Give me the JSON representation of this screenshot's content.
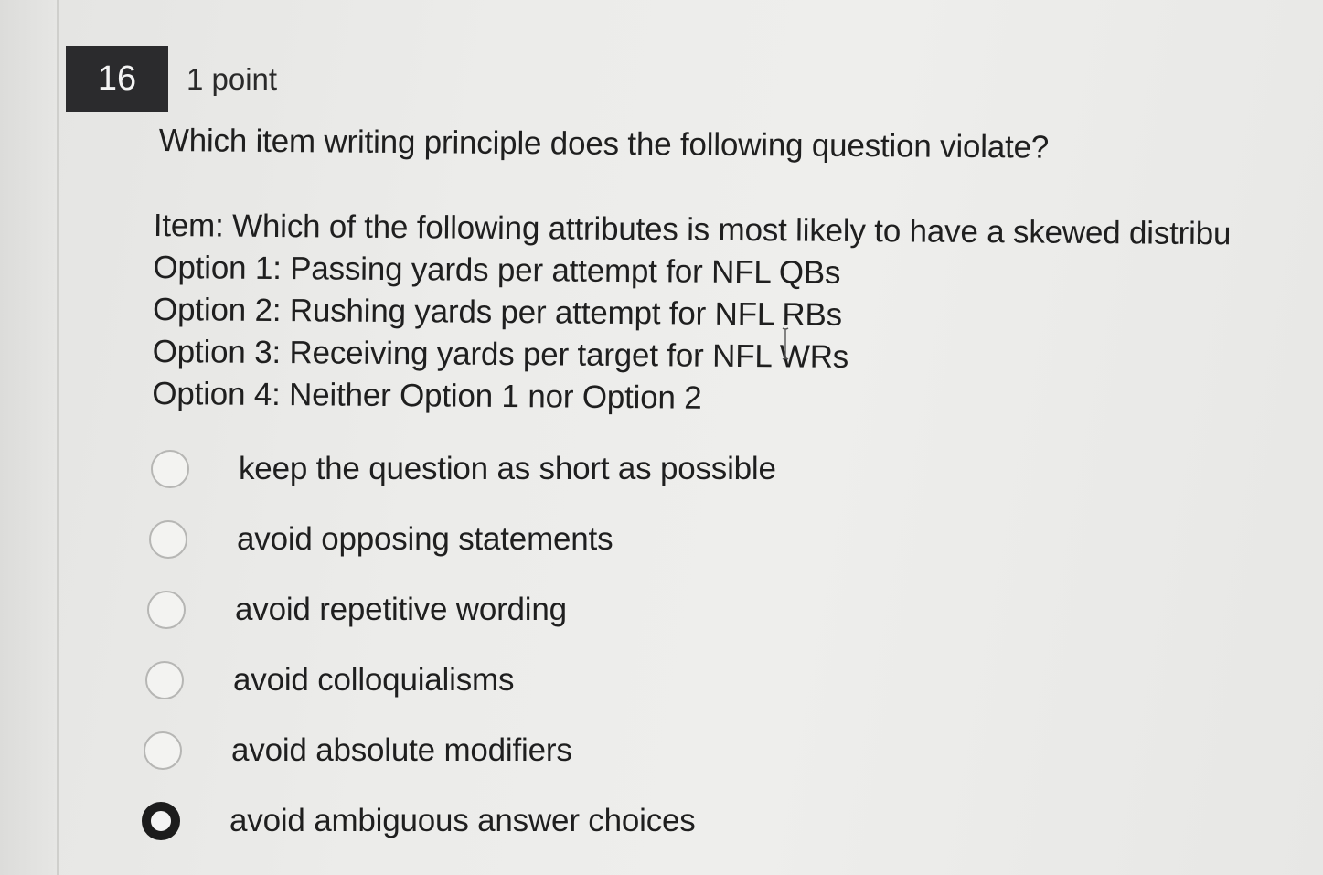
{
  "question": {
    "number": "16",
    "points": "1 point",
    "stem": "Which item writing principle does the following question violate?",
    "item_lines": [
      "Item: Which of the following attributes is most likely to have a skewed distribu",
      "Option 1: Passing yards per attempt for NFL QBs",
      "Option 2: Rushing yards per attempt for NFL RBs",
      "Option 3: Receiving yards per target for NFL WRs",
      "Option 4: Neither Option 1 nor Option 2"
    ]
  },
  "choices": [
    {
      "label": "keep the question as short as possible",
      "selected": false
    },
    {
      "label": "avoid opposing statements",
      "selected": false
    },
    {
      "label": "avoid repetitive wording",
      "selected": false
    },
    {
      "label": "avoid colloquialisms",
      "selected": false
    },
    {
      "label": "avoid absolute modifiers",
      "selected": false
    },
    {
      "label": "avoid ambiguous answer choices",
      "selected": true
    }
  ],
  "colors": {
    "number_box_bg": "#2b2b2d",
    "selected_radio": "#1c1c1c",
    "unselected_radio_border": "#b6b6b4"
  },
  "icons": [
    "radio-unselected-icon",
    "radio-selected-icon",
    "text-cursor-icon"
  ]
}
